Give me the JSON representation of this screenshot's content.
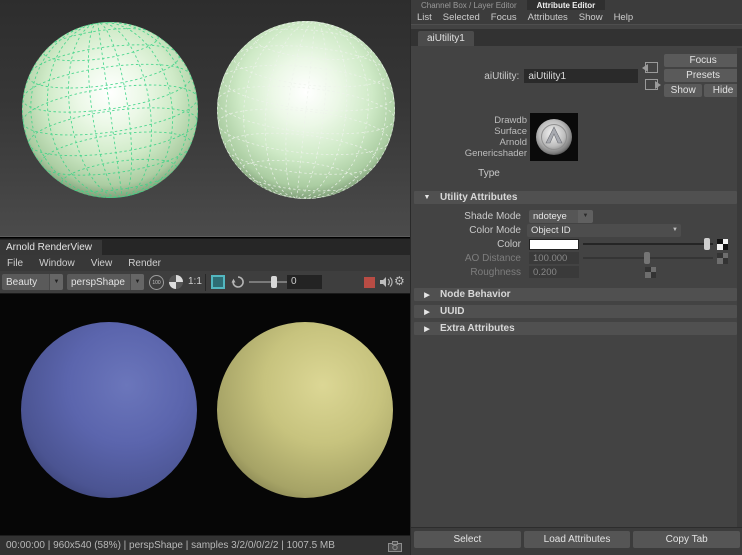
{
  "icons": {
    "chevron_down": "▼",
    "chevron_right": "▶",
    "gear": "⚙"
  },
  "colors": {
    "marquee_teal": "#53b7c0",
    "record_red": "#b84c44",
    "left_wireframe_green": "#3ed488",
    "right_wireframe_white": "#eef3ec",
    "render_sphere_blue": "#5b65ad",
    "render_sphere_yellow": "#c7c37e",
    "color_swatch_white": "#ffffff"
  },
  "viewport": {
    "left_sphere": {
      "wireframe_color": "#3ed488"
    },
    "right_sphere": {
      "wireframe_color": "#eef3ec"
    }
  },
  "renderview": {
    "tab": "Arnold RenderView",
    "menus": [
      "File",
      "Window",
      "View",
      "Render"
    ],
    "aov_select": "Beauty",
    "camera_select": "perspShape",
    "zoom_ratio_label": "1:1",
    "debug_value": "0",
    "status": "00:00:00 | 960x540 (58%) | perspShape  | samples 3/2/0/0/2/2 | 1007.5 MB"
  },
  "attribute_editor": {
    "tabs": {
      "channel_box": "Channel Box / Layer Editor",
      "attribute_editor": "Attribute Editor"
    },
    "menus": [
      "List",
      "Selected",
      "Focus",
      "Attributes",
      "Show",
      "Help"
    ],
    "node_tab": "aiUtility1",
    "name_field": {
      "label": "aiUtility:",
      "value": "aiUtility1"
    },
    "buttons": {
      "focus": "Focus",
      "presets": "Presets",
      "show": "Show",
      "hide": "Hide"
    },
    "type_block": {
      "lines": [
        "Drawdb",
        "Surface",
        "Arnold",
        "Genericshader"
      ],
      "caption": "Type"
    },
    "sections": [
      {
        "label": "Utility Attributes",
        "expanded": true
      },
      {
        "label": "Node Behavior",
        "expanded": false
      },
      {
        "label": "UUID",
        "expanded": false
      },
      {
        "label": "Extra Attributes",
        "expanded": false
      }
    ],
    "fields": {
      "shade_mode": {
        "label": "Shade Mode",
        "value": "ndoteye"
      },
      "color_mode": {
        "label": "Color Mode",
        "value": "Object ID"
      },
      "color": {
        "label": "Color",
        "swatch": "#ffffff"
      },
      "ao_distance": {
        "label": "AO Distance",
        "value": "100.000",
        "disabled": true
      },
      "roughness": {
        "label": "Roughness",
        "value": "0.200",
        "disabled": true
      }
    },
    "footer_buttons": [
      "Select",
      "Load Attributes",
      "Copy Tab"
    ]
  }
}
